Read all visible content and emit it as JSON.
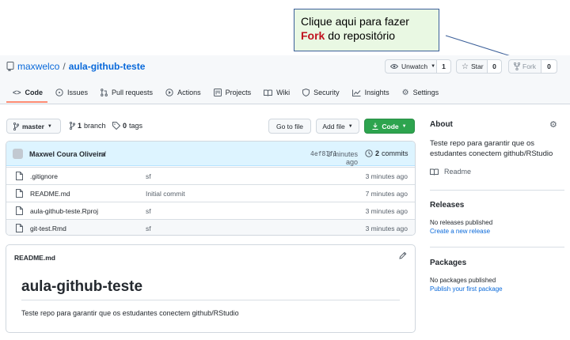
{
  "callout": {
    "line1": "Clique aqui para fazer",
    "fork_word": "Fork",
    "line2_rest": " do repositório"
  },
  "repo": {
    "owner": "maxwelco",
    "separator": "/",
    "name": "aula-github-teste"
  },
  "actions": {
    "watch_label": "Unwatch",
    "watch_count": "1",
    "star_label": "Star",
    "star_count": "0",
    "fork_label": "Fork",
    "fork_count": "0"
  },
  "tabs": [
    {
      "label": "Code",
      "icon": "code-icon"
    },
    {
      "label": "Issues",
      "icon": "issue-icon"
    },
    {
      "label": "Pull requests",
      "icon": "pull-request-icon"
    },
    {
      "label": "Actions",
      "icon": "play-icon"
    },
    {
      "label": "Projects",
      "icon": "project-icon"
    },
    {
      "label": "Wiki",
      "icon": "book-icon"
    },
    {
      "label": "Security",
      "icon": "shield-icon"
    },
    {
      "label": "Insights",
      "icon": "graph-icon"
    },
    {
      "label": "Settings",
      "icon": "gear-icon"
    }
  ],
  "branchbar": {
    "branch": "master",
    "branch_count": "1",
    "branch_word": "branch",
    "tag_count": "0",
    "tag_word": "tags",
    "goto_file": "Go to file",
    "add_file": "Add file",
    "code": "Code"
  },
  "commit": {
    "author": "Maxwel Coura Oliveira",
    "message": "sf",
    "sha": "4ef81f1",
    "age": "3 minutes ago",
    "count": "2",
    "count_word": "commits"
  },
  "files": [
    {
      "name": ".gitignore",
      "message": "sf",
      "age": "3 minutes ago"
    },
    {
      "name": "README.md",
      "message": "Initial commit",
      "age": "7 minutes ago"
    },
    {
      "name": "aula-github-teste.Rproj",
      "message": "sf",
      "age": "3 minutes ago"
    },
    {
      "name": "git-test.Rmd",
      "message": "sf",
      "age": "3 minutes ago"
    }
  ],
  "readme": {
    "filename": "README.md",
    "heading": "aula-github-teste",
    "body": "Teste repo para garantir que os estudantes conectem github/RStudio"
  },
  "sidebar": {
    "about_title": "About",
    "about_line1": "Teste repo para garantir que os",
    "about_line2": "estudantes conectem github/RStudio",
    "readme_link": "Readme",
    "releases_title": "Releases",
    "releases_none": "No releases published",
    "releases_link": "Create a new release",
    "packages_title": "Packages",
    "packages_none": "No packages published",
    "packages_link": "Publish your first package"
  },
  "colors": {
    "green_button": "#2da44e",
    "link": "#0969da",
    "tab_underline": "#fd8c73",
    "callout_bg": "#e9f8e3",
    "fork_word": "#c0111f"
  }
}
